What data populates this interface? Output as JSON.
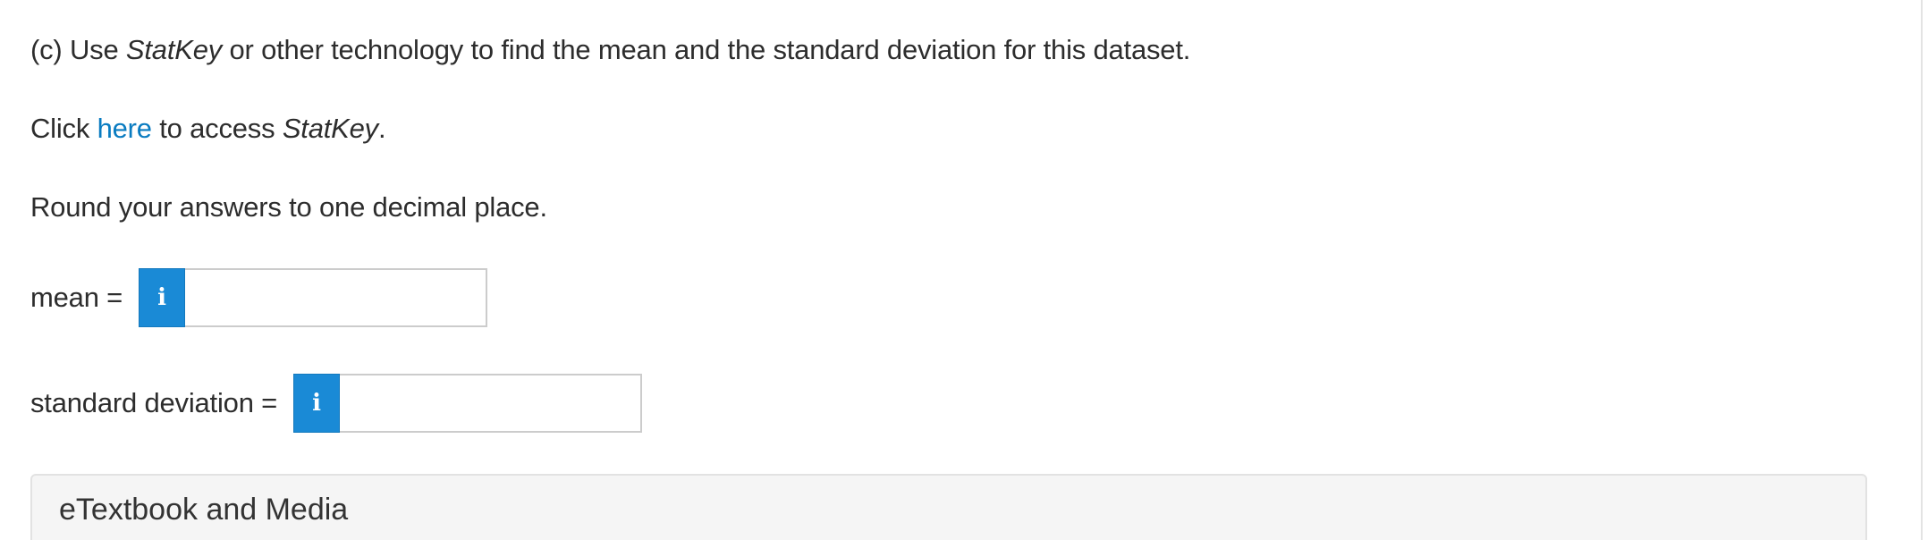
{
  "question": {
    "part_prefix": "(c) Use ",
    "part_tool": "StatKey",
    "part_suffix": " or other technology to find the mean and the standard deviation for this dataset."
  },
  "access": {
    "prefix": "Click ",
    "link_text": "here",
    "middle": " to access ",
    "tool": "StatKey",
    "suffix": "."
  },
  "instruction": "Round your answers to one decimal place.",
  "fields": {
    "mean": {
      "label": "mean =",
      "info_icon": "i",
      "value": ""
    },
    "std_dev": {
      "label": "standard deviation =",
      "info_icon": "i",
      "value": ""
    }
  },
  "media_panel": {
    "title": "eTextbook and Media"
  },
  "colors": {
    "link": "#0a7cc1",
    "info_button": "#1a8ad6",
    "panel_bg": "#f5f5f5"
  }
}
